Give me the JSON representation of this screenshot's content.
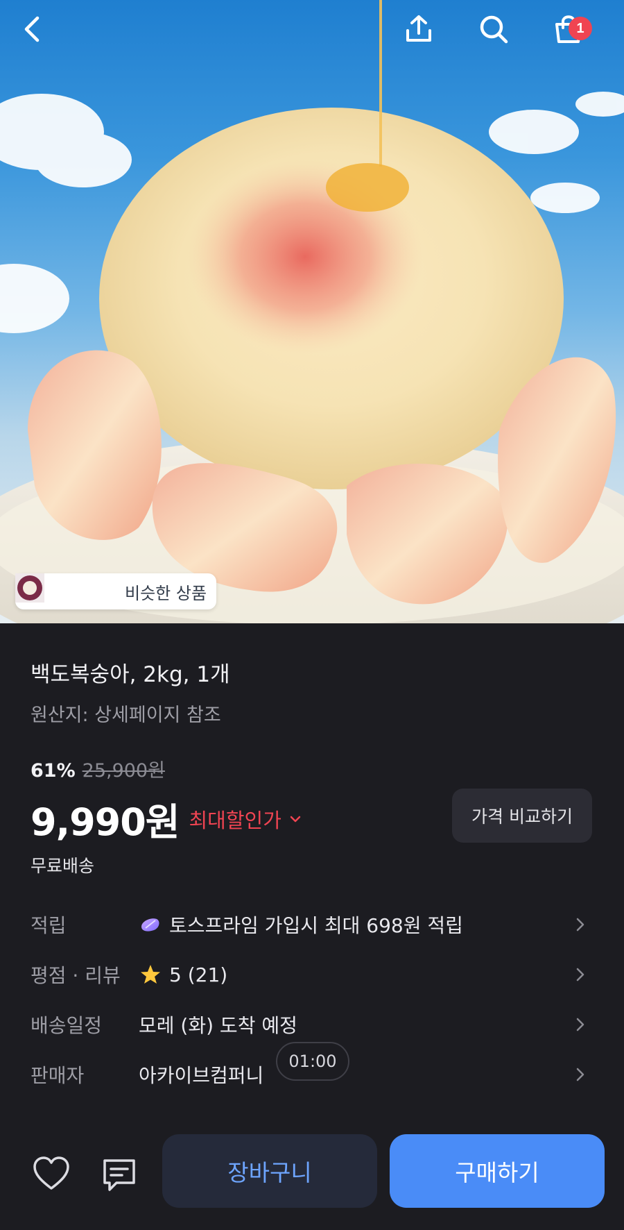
{
  "topbar": {
    "back_icon": "chevron-left-icon",
    "share_icon": "share-icon",
    "search_icon": "search-icon",
    "cart_icon": "shopping-bag-icon",
    "cart_count": "1"
  },
  "hero": {
    "similar_label": "비슷한 상품"
  },
  "product": {
    "title": "백도복숭아, 2kg, 1개",
    "origin": "원산지: 상세페이지 참조",
    "discount_pct": "61%",
    "original_price": "25,900원",
    "price": "9,990원",
    "max_discount_label": "최대할인가",
    "compare_label": "가격 비교하기",
    "shipping": "무료배송"
  },
  "info": {
    "rows": [
      {
        "key": "적립",
        "value": "토스프라임 가입시 최대 698원 적립",
        "icon": "prime-icon"
      },
      {
        "key": "평점 · 리뷰",
        "value": "5 (21)",
        "icon": "star-icon"
      },
      {
        "key": "배송일정",
        "value": "모레 (화) 도착 예정"
      },
      {
        "key": "판매자",
        "value": "아카이브컴퍼니"
      }
    ],
    "timer": "01:00"
  },
  "bottom": {
    "cart_label": "장바구니",
    "buy_label": "구매하기"
  },
  "colors": {
    "background": "#1c1c21",
    "accent_blue": "#4a8cf7",
    "discount_red": "#f04452",
    "badge_red": "#f04452"
  }
}
